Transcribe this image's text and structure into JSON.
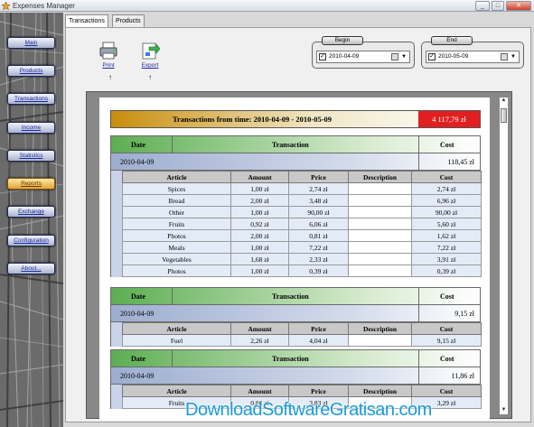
{
  "window": {
    "title": "Expenses Manager"
  },
  "sidebar": {
    "items": [
      {
        "label": "Main"
      },
      {
        "label": "Products"
      },
      {
        "label": "Transactions"
      },
      {
        "label": "Income"
      },
      {
        "label": "Statistics"
      },
      {
        "label": "Reports",
        "active": true
      },
      {
        "label": "Exchange"
      },
      {
        "label": "Configuration"
      },
      {
        "label": "About..."
      }
    ]
  },
  "tabs": [
    {
      "label": "Transactions"
    },
    {
      "label": "Products"
    }
  ],
  "toolbar": {
    "print_label": "Print",
    "export_label": "Export"
  },
  "date_range": {
    "begin": {
      "caption": "Begin",
      "value": "2010-04-09",
      "checked": true
    },
    "end": {
      "caption": "End",
      "value": "2010-05-09",
      "checked": true
    }
  },
  "report": {
    "summary_title": "Transactions from time: 2010-04-09 - 2010-05-09",
    "summary_total": "4 117,79 zł",
    "group_headers": {
      "date": "Date",
      "transaction": "Transaction",
      "cost": "Cost"
    },
    "item_headers": {
      "article": "Article",
      "amount": "Amount",
      "price": "Price",
      "description": "Description",
      "cost": "Cost"
    },
    "groups": [
      {
        "date": "2010-04-09",
        "cost": "118,45 zł",
        "items": [
          {
            "article": "Spices",
            "amount": "1,00 zł",
            "price": "2,74 zł",
            "description": "",
            "cost": "2,74 zł"
          },
          {
            "article": "Bread",
            "amount": "2,00 zł",
            "price": "3,48 zł",
            "description": "",
            "cost": "6,96 zł"
          },
          {
            "article": "Other",
            "amount": "1,00 zł",
            "price": "90,00 zł",
            "description": "",
            "cost": "90,00 zł"
          },
          {
            "article": "Fruits",
            "amount": "0,92 zł",
            "price": "6,06 zł",
            "description": "",
            "cost": "5,60 zł"
          },
          {
            "article": "Photos",
            "amount": "2,00 zł",
            "price": "0,81 zł",
            "description": "",
            "cost": "1,62 zł"
          },
          {
            "article": "Meals",
            "amount": "1,00 zł",
            "price": "7,22 zł",
            "description": "",
            "cost": "7,22 zł"
          },
          {
            "article": "Vegetables",
            "amount": "1,68 zł",
            "price": "2,33 zł",
            "description": "",
            "cost": "3,91 zł"
          },
          {
            "article": "Photos",
            "amount": "1,00 zł",
            "price": "0,39 zł",
            "description": "",
            "cost": "0,39 zł"
          }
        ]
      },
      {
        "date": "2010-04-09",
        "cost": "9,15 zł",
        "items": [
          {
            "article": "Fuel",
            "amount": "2,26 zł",
            "price": "4,04 zł",
            "description": "",
            "cost": "9,15 zł"
          }
        ]
      },
      {
        "date": "2010-04-09",
        "cost": "11,86 zł",
        "items": [
          {
            "article": "Fruits",
            "amount": "0,86 zł",
            "price": "3,83 zł",
            "description": "",
            "cost": "3,29 zł"
          }
        ]
      }
    ]
  },
  "watermark": "DownloadSoftwareGratisan.com"
}
